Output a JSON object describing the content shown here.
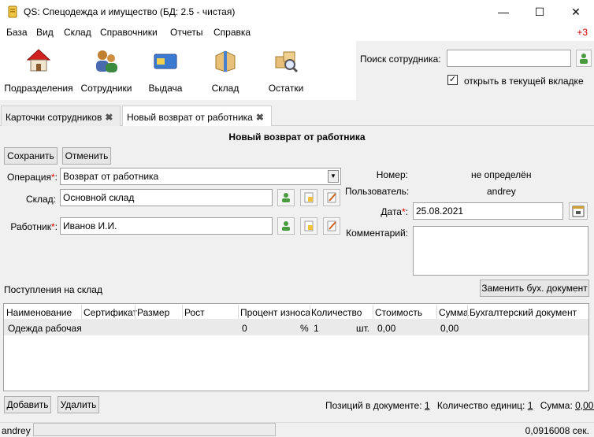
{
  "window": {
    "title": "QS: Спецодежда и имущество (БД: 2.5 - чистая)",
    "minimize": "—",
    "maximize": "☐",
    "close": "✕"
  },
  "menu": [
    "База",
    "Вид",
    "Склад",
    "Справочники",
    "Отчеты",
    "Справка"
  ],
  "notification": "+3",
  "toolbar": [
    {
      "label": "Подразделения",
      "icon": "house-icon"
    },
    {
      "label": "Сотрудники",
      "icon": "people-icon"
    },
    {
      "label": "Выдача",
      "icon": "card-icon"
    },
    {
      "label": "Склад",
      "icon": "box-icon"
    },
    {
      "label": "Остатки",
      "icon": "boxes-search-icon"
    }
  ],
  "search": {
    "label": "Поиск сотрудника:",
    "value": "",
    "open_in_current_tab": "открыть в текущей вкладке",
    "checked": true
  },
  "tabs": [
    {
      "label": "Карточки сотрудников",
      "active": false
    },
    {
      "label": "Новый возврат от работника",
      "active": true
    }
  ],
  "form": {
    "title": "Новый возврат от работника",
    "save": "Сохранить",
    "cancel": "Отменить",
    "operation_label": "Операция",
    "operation_value": "Возврат от работника",
    "warehouse_label": "Склад:",
    "warehouse_value": "Основной склад",
    "worker_label": "Работник",
    "worker_value": "Иванов И.И.",
    "number_label": "Номер:",
    "number_value": "не определён",
    "user_label": "Пользователь:",
    "user_value": "andrey",
    "date_label": "Дата",
    "date_value": "25.08.2021",
    "comment_label": "Комментарий:",
    "comment_value": "",
    "required_mark": "*",
    "colon": ":"
  },
  "receipts": {
    "label": "Поступления на склад",
    "replace_doc": "Заменить бух. документ",
    "columns": [
      "Наименование",
      "Сертификат",
      "Размер",
      "Рост",
      "Процент износа",
      "Количество",
      "Стоимость",
      "Сумма",
      "Бухгалтерский документ"
    ],
    "rows": [
      {
        "name": "Одежда рабочая",
        "certificate": "",
        "size": "",
        "height": "",
        "wear": "0",
        "wear_unit": "%",
        "quantity": "1",
        "unit": "шт.",
        "cost": "0,00",
        "sum": "0,00",
        "doc": ""
      }
    ],
    "add": "Добавить",
    "delete": "Удалить",
    "positions_label": "Позиций в документе:",
    "positions_value": "1",
    "units_label": "Количество единиц:",
    "units_value": "1",
    "sum_label": "Сумма:",
    "sum_value": "0,00 ₽"
  },
  "status": {
    "user": "andrey",
    "time": "0,0916008 сек."
  }
}
